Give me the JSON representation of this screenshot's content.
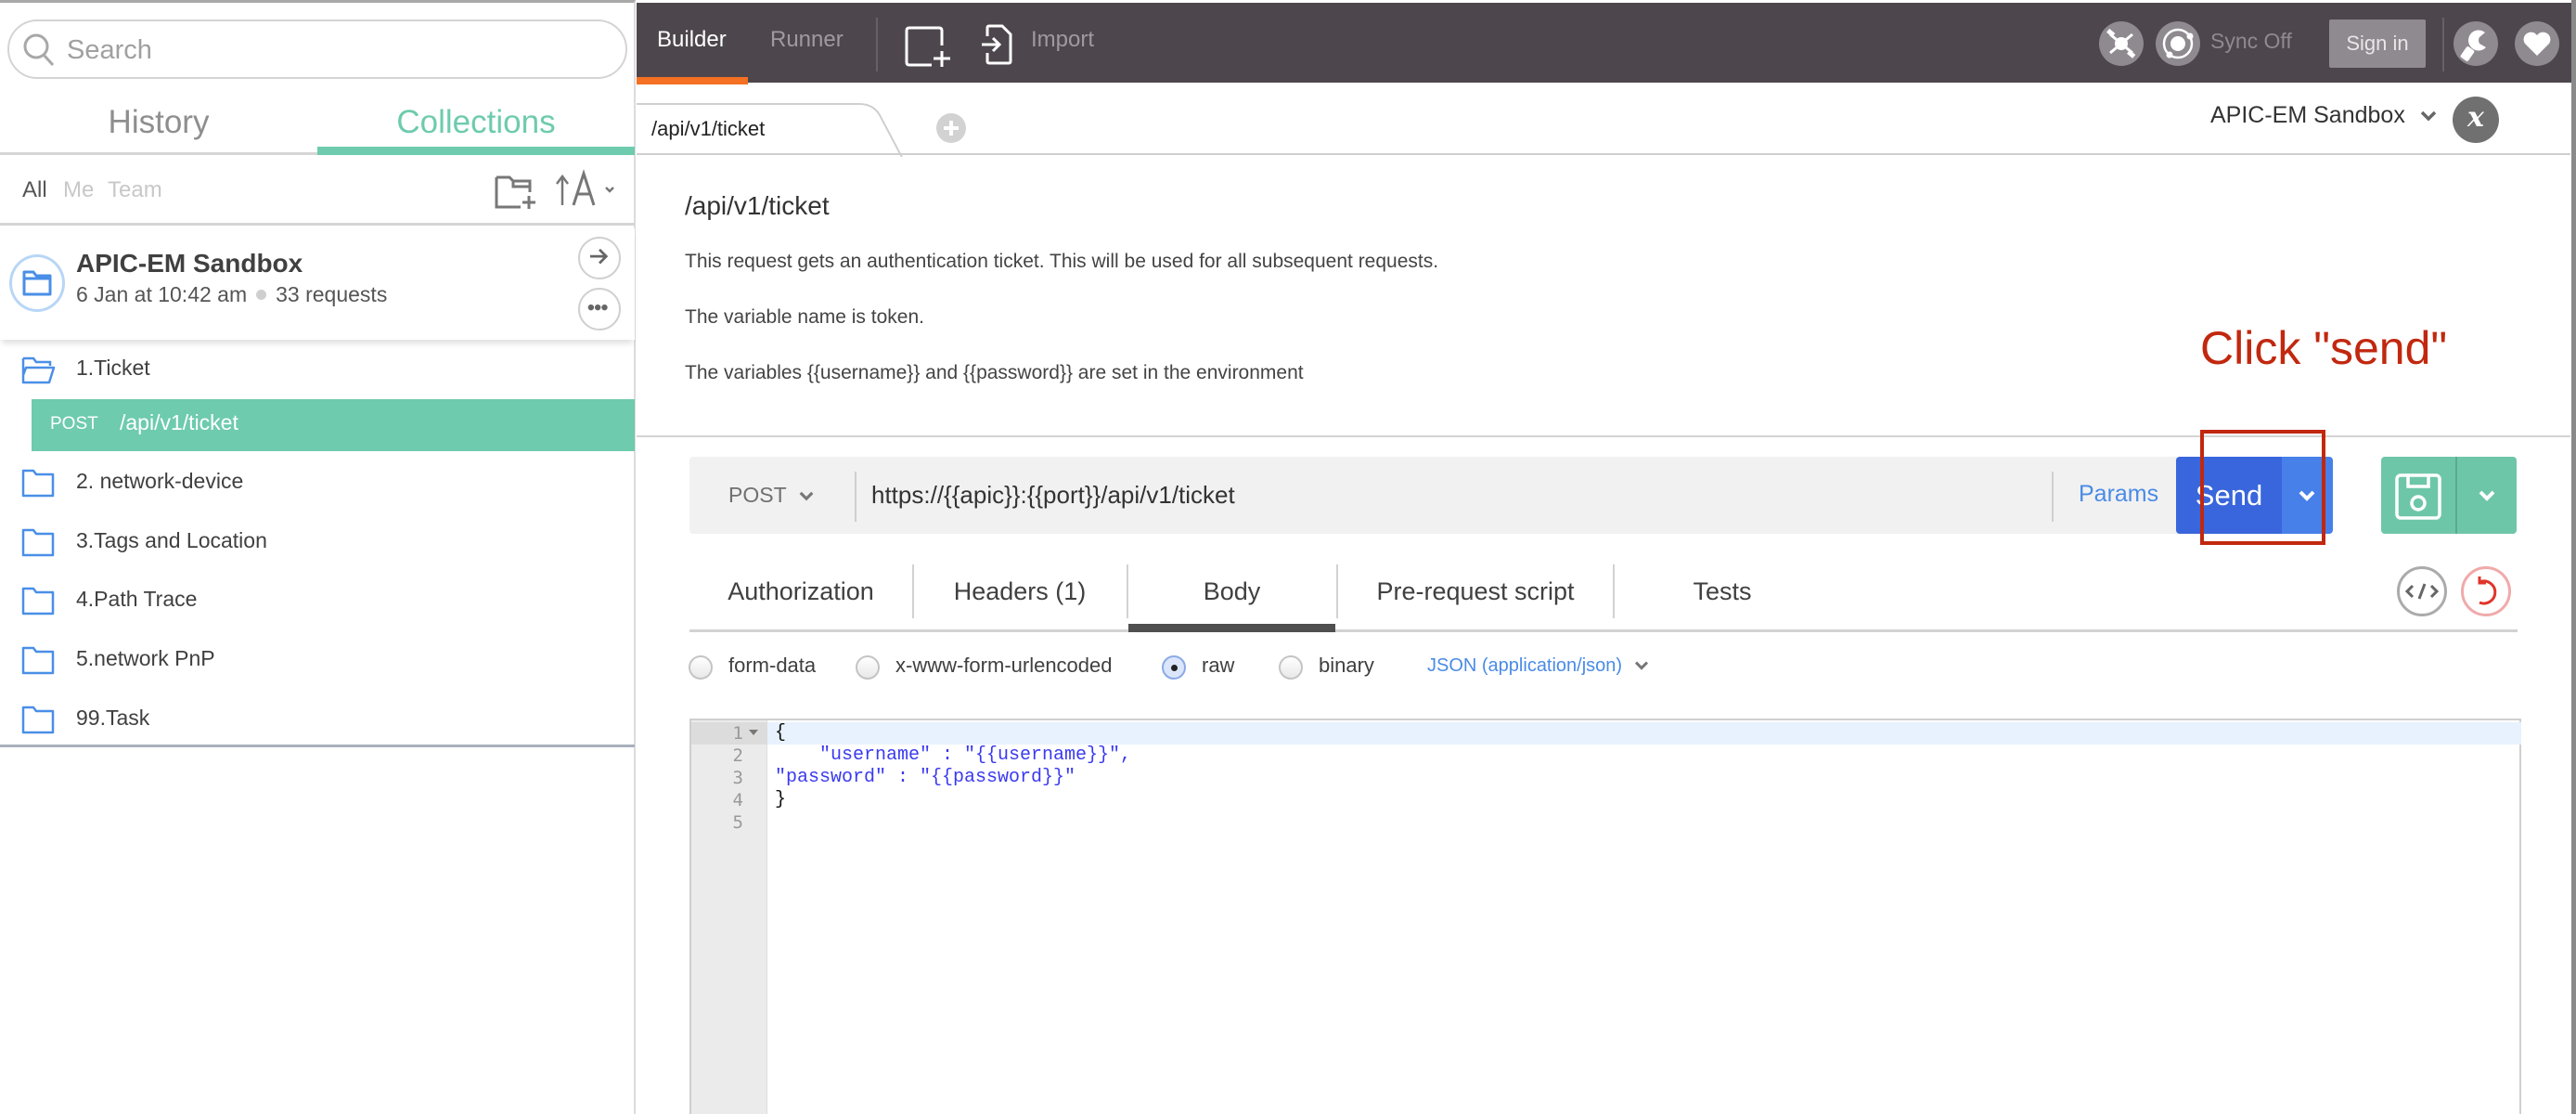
{
  "sidebar": {
    "search_placeholder": "Search",
    "tabs": {
      "history": "History",
      "collections": "Collections",
      "active": "Collections"
    },
    "filters": {
      "all": "All",
      "me": "Me",
      "team": "Team",
      "active": "All"
    },
    "collection": {
      "name": "APIC-EM Sandbox",
      "updated": "6 Jan at 10:42 am",
      "requests": "33 requests"
    },
    "folders": [
      {
        "label": "1.Ticket",
        "open": true
      },
      {
        "label": "2. network-device",
        "open": false
      },
      {
        "label": "3.Tags and Location",
        "open": false
      },
      {
        "label": "4.Path Trace",
        "open": false
      },
      {
        "label": "5.network PnP",
        "open": false
      },
      {
        "label": "99.Task",
        "open": false
      }
    ],
    "selected_request": {
      "method": "POST",
      "url": "/api/v1/ticket"
    }
  },
  "topbar": {
    "builder": "Builder",
    "runner": "Runner",
    "import": "Import",
    "sync": "Sync Off",
    "sign_in": "Sign in",
    "icons": [
      "new-tab-icon",
      "import-icon",
      "interceptor-icon",
      "sync-icon",
      "settings-icon",
      "heart-icon"
    ]
  },
  "request_tab": {
    "label": "/api/v1/ticket"
  },
  "environment": {
    "selected": "APIC-EM Sandbox",
    "quicklook": "x"
  },
  "description": {
    "title": "/api/v1/ticket",
    "lines": [
      "This request gets an authentication ticket. This will be used for all subsequent requests.",
      "The variable name is token.",
      "The variables {{username}} and {{password}} are set in the environment"
    ]
  },
  "annotation": {
    "text": "Click \"send\"",
    "color": "#c1280f"
  },
  "url_bar": {
    "method": "POST",
    "url": "https://{{apic}}:{{port}}/api/v1/ticket",
    "params": "Params",
    "send": "Send"
  },
  "builder_tabs": {
    "items": [
      "Authorization",
      "Headers (1)",
      "Body",
      "Pre-request script",
      "Tests"
    ],
    "active": "Body"
  },
  "body_types": {
    "options": [
      "form-data",
      "x-www-form-urlencoded",
      "raw",
      "binary"
    ],
    "selected": "raw",
    "content_type": "JSON (application/json)"
  },
  "editor": {
    "line_numbers": [
      "1",
      "2",
      "3",
      "4",
      "5"
    ],
    "lines": [
      "{",
      "    \"username\" : \"{{username}}\",",
      "\"password\" : \"{{password}}\"",
      "}",
      ""
    ]
  },
  "colors": {
    "accent_teal": "#6ecbad",
    "send_blue": "#3966dc",
    "topbar": "#4d474d",
    "builder_orange": "#f47023",
    "link_blue": "#4a8be6"
  }
}
